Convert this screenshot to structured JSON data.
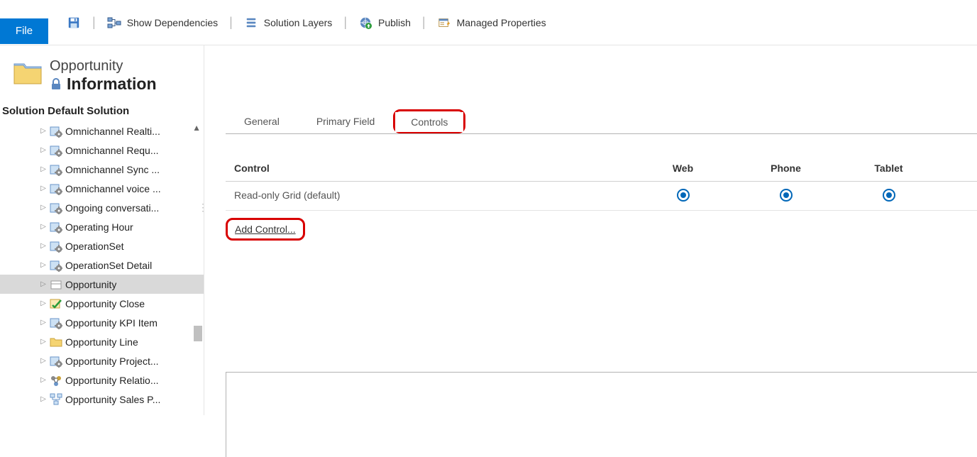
{
  "toolbar": {
    "file_label": "File",
    "show_dependencies": "Show Dependencies",
    "solution_layers": "Solution Layers",
    "publish": "Publish",
    "managed_properties": "Managed Properties"
  },
  "header": {
    "entity": "Opportunity",
    "subtitle": "Information"
  },
  "solution": {
    "label_prefix": "Solution",
    "name": "Default Solution"
  },
  "tree": {
    "items": [
      {
        "label": "Omnichannel Realti...",
        "icon": "gear"
      },
      {
        "label": "Omnichannel Requ...",
        "icon": "gear"
      },
      {
        "label": "Omnichannel Sync ...",
        "icon": "gear"
      },
      {
        "label": "Omnichannel voice ...",
        "icon": "gear"
      },
      {
        "label": "Ongoing conversati...",
        "icon": "gear"
      },
      {
        "label": "Operating Hour",
        "icon": "gear"
      },
      {
        "label": "OperationSet",
        "icon": "gear"
      },
      {
        "label": "OperationSet Detail",
        "icon": "gear"
      },
      {
        "label": "Opportunity",
        "icon": "entity",
        "selected": true
      },
      {
        "label": "Opportunity Close",
        "icon": "check"
      },
      {
        "label": "Opportunity KPI Item",
        "icon": "gear"
      },
      {
        "label": "Opportunity Line",
        "icon": "folder"
      },
      {
        "label": "Opportunity Project...",
        "icon": "gear"
      },
      {
        "label": "Opportunity Relatio...",
        "icon": "relation"
      },
      {
        "label": "Opportunity Sales P...",
        "icon": "process"
      }
    ]
  },
  "tabs": {
    "general": "General",
    "primary_field": "Primary Field",
    "controls": "Controls"
  },
  "grid": {
    "headers": {
      "control": "Control",
      "web": "Web",
      "phone": "Phone",
      "tablet": "Tablet"
    },
    "rows": [
      {
        "control": "Read-only Grid (default)",
        "web": true,
        "phone": true,
        "tablet": true
      }
    ]
  },
  "add_control_label": "Add Control..."
}
